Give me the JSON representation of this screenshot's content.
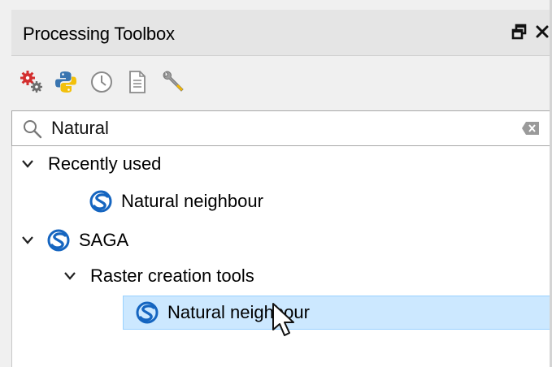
{
  "panel": {
    "title": "Processing Toolbox",
    "float_icon": "float-window-icon",
    "close_icon": "close-icon"
  },
  "toolbar": {
    "icons": [
      "models-gear-icon",
      "python-icon",
      "history-clock-icon",
      "results-document-icon",
      "options-wrench-icon"
    ]
  },
  "search": {
    "value": "Natural",
    "icon": "search-icon",
    "clear_icon": "clear-icon"
  },
  "tree": {
    "recently_used": {
      "label": "Recently used",
      "items": [
        {
          "label": "Natural neighbour",
          "icon": "saga-icon"
        }
      ]
    },
    "saga": {
      "label": "SAGA",
      "icon": "saga-icon",
      "groups": [
        {
          "label": "Raster creation tools",
          "items": [
            {
              "label": "Natural neighbour",
              "icon": "saga-icon",
              "selected": true
            }
          ]
        }
      ]
    }
  },
  "colors": {
    "selection_bg": "#cce8ff",
    "selection_border": "#99d1ff",
    "saga_blue": "#1565c0"
  }
}
